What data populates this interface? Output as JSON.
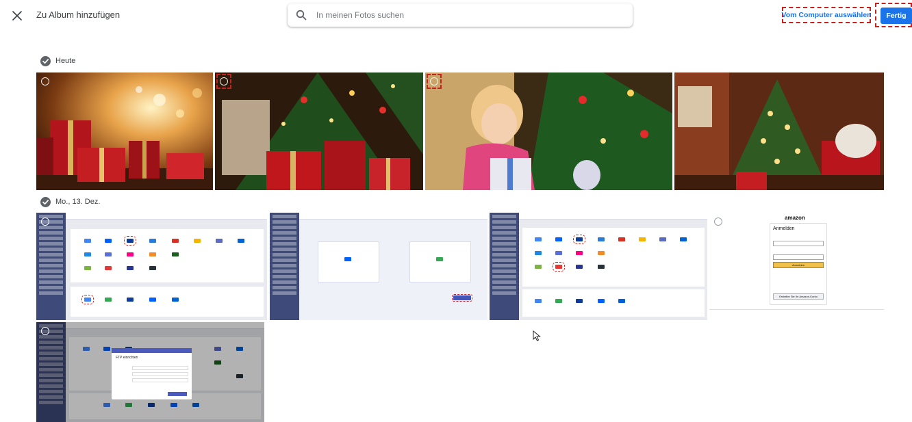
{
  "header": {
    "title": "Zu Album hinzufügen",
    "close_icon": "close-icon",
    "search": {
      "placeholder": "In meinen Fotos suchen",
      "value": ""
    },
    "computer_button": "Vom Computer auswählen",
    "done_button": "Fertig"
  },
  "colors": {
    "accent": "#1a73e8",
    "highlight": "#c5221f",
    "sidebar": "#3e4a7a"
  },
  "sections": [
    {
      "label": "Heute",
      "photos": [
        "christmas-gifts-bokeh",
        "christmas-gifts-tree",
        "girl-opening-gift",
        "christmas-living-room"
      ]
    },
    {
      "label": "Mo., 13. Dez.",
      "photos": [
        "multcloud-add-cloud",
        "multcloud-cloud-backup",
        "multcloud-add-cloud-2",
        "amazon-signin",
        "multcloud-ftp-dialog"
      ]
    }
  ],
  "amazon": {
    "logo": "amazon",
    "heading": "Anmelden",
    "button": "Anmelden",
    "create": "Erstellen Sie Ihr Amazon-Konto"
  },
  "multcloud": {
    "dialog_title": "FTP einrichten"
  }
}
